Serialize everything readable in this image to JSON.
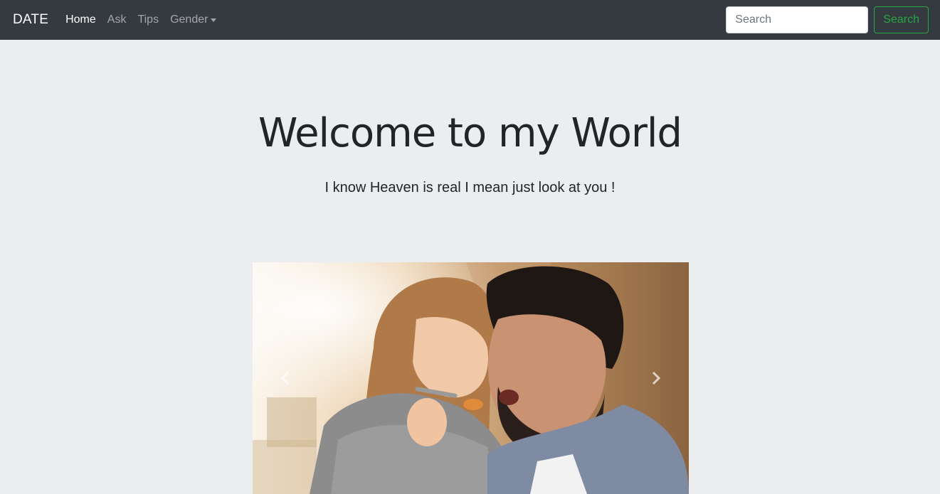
{
  "navbar": {
    "brand": "DATE",
    "links": [
      {
        "label": "Home",
        "active": true
      },
      {
        "label": "Ask",
        "active": false
      },
      {
        "label": "Tips",
        "active": false
      },
      {
        "label": "Gender",
        "active": false,
        "dropdown": true
      }
    ],
    "search": {
      "placeholder": "Search",
      "value": "",
      "button_label": "Search"
    }
  },
  "hero": {
    "title": "Welcome to my World",
    "subtitle": "I know Heaven is real I mean just look at you !"
  },
  "carousel": {
    "prev_icon": "chevron-left-icon",
    "next_icon": "chevron-right-icon"
  },
  "colors": {
    "navbar_bg": "#343a40",
    "page_bg": "#ecedef",
    "search_button": "#28a745"
  }
}
